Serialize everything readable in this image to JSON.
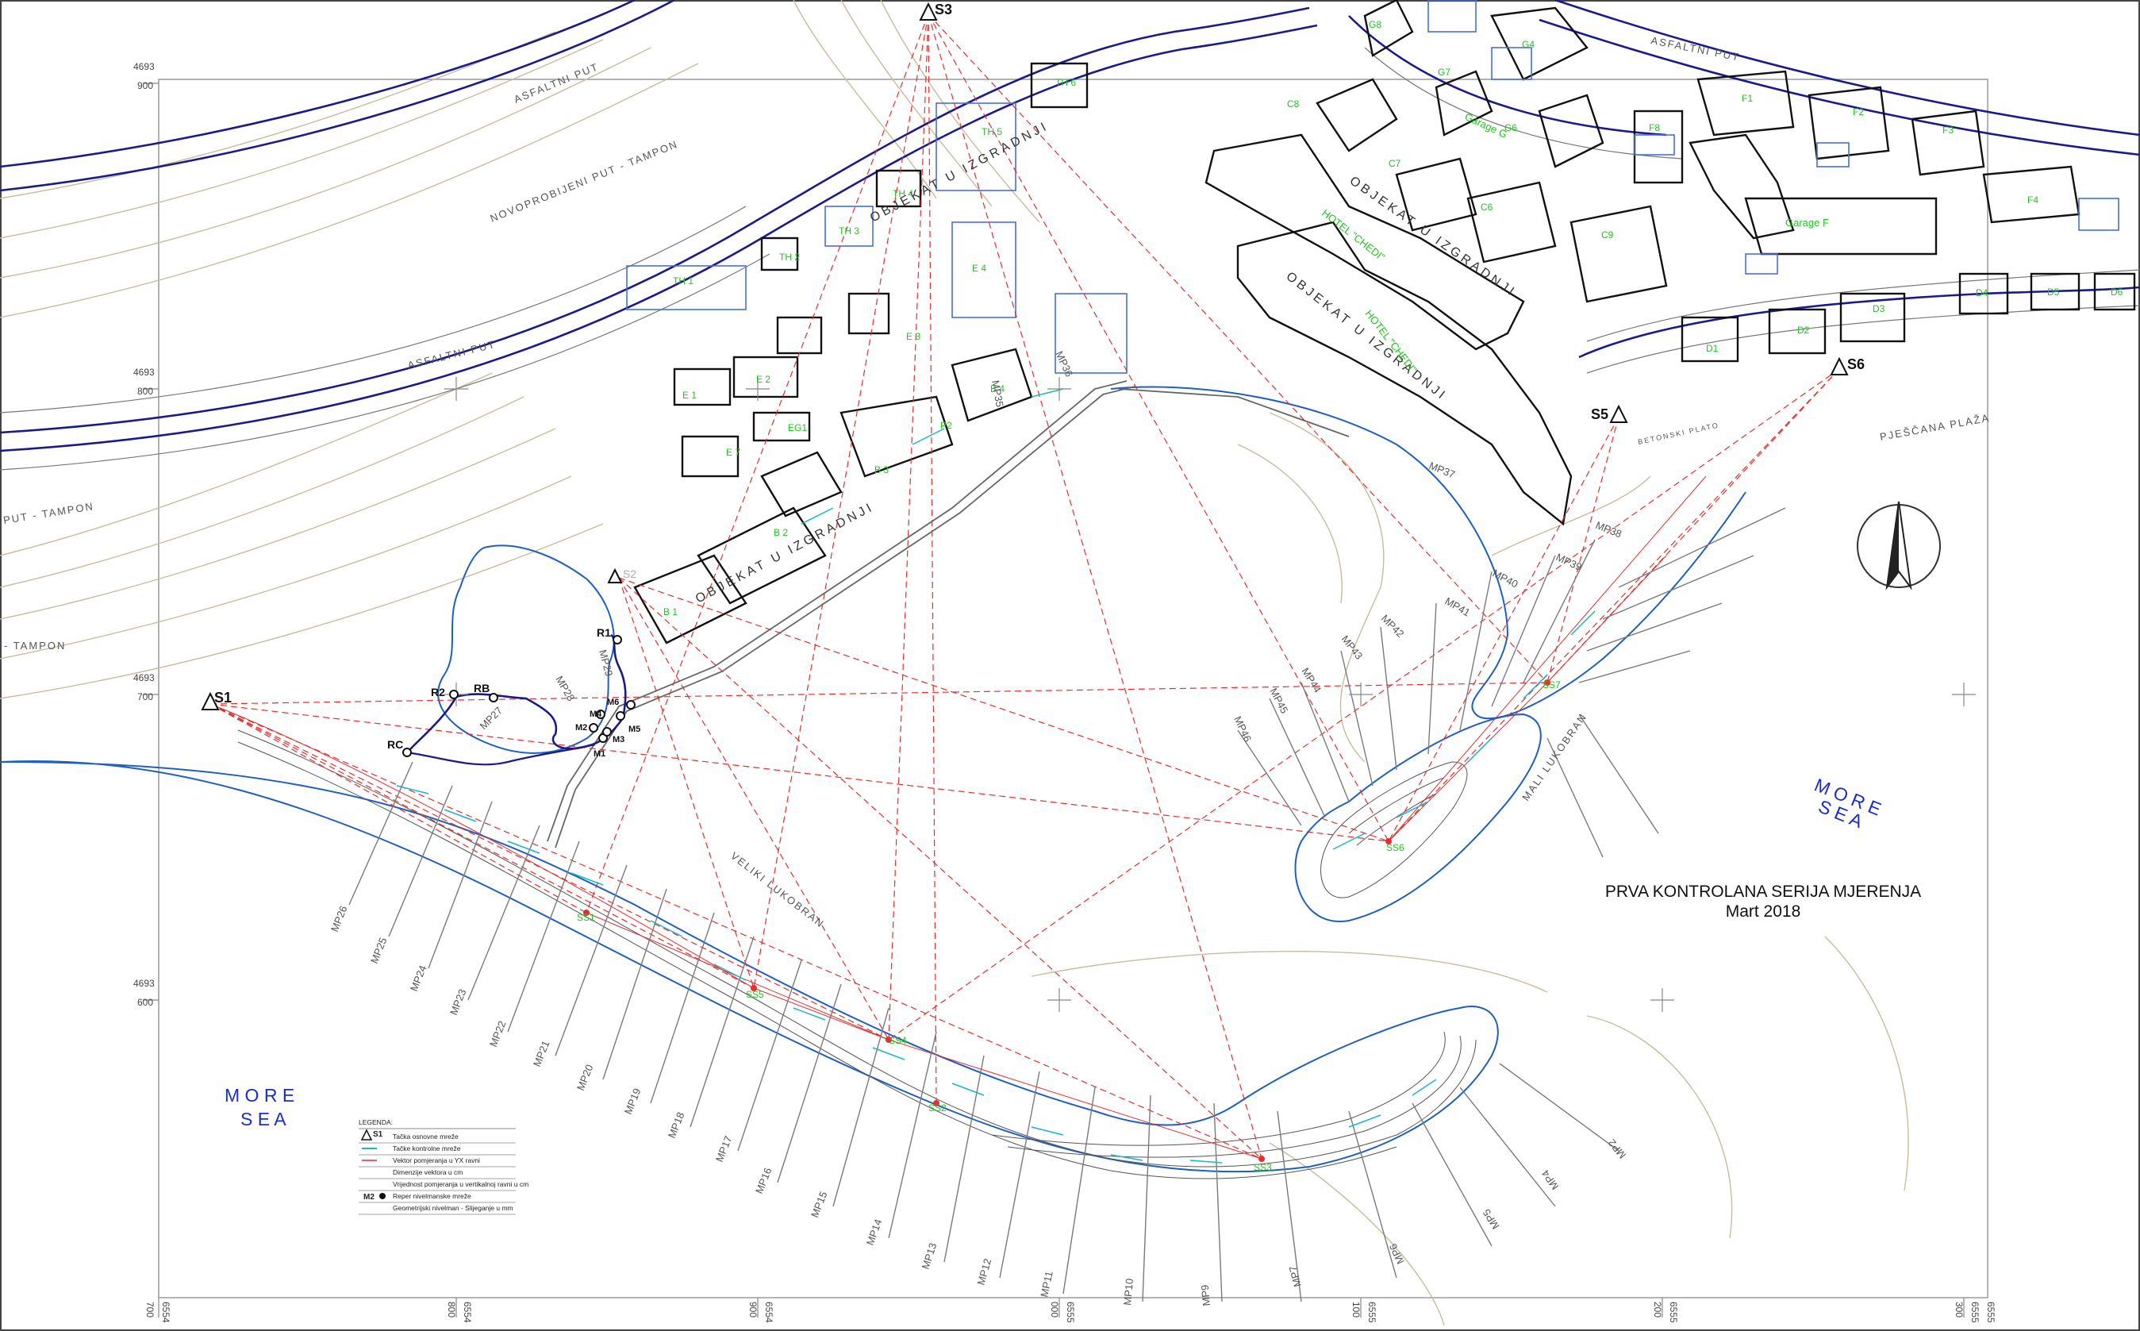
{
  "title": {
    "line1": "PRVA KONTROLANA SERIJA MJERENJA",
    "line2": "Mart 2018"
  },
  "sea_labels": {
    "left": [
      "M O R E",
      "S E A"
    ],
    "right": [
      "M O R E",
      "S E A"
    ]
  },
  "road_labels": {
    "asfaltni_1": "ASFALTNI PUT",
    "asfaltni_2": "ASFALTNI PUT",
    "novoprobijeni": "NOVOPROBIJENI PUT - TAMPON",
    "put_tampon_1": "PUT - TAMPON",
    "put_tampon_2": "- TAMPON",
    "betonski": "BETONSKI PLATO",
    "pjescana": "PJEŠČANA PLAŽA",
    "mali_lukobran": "MALI LUKOBRAN",
    "veliki_lukobran": "VELIKI LUKOBRAN"
  },
  "buildings": {
    "objekat_u_izgradnji": "OBJEKAT U IZGRADNJI",
    "hotel_chedi": "HOTEL \"CHEDI\"",
    "garage_g": "Garage G",
    "garage_f": "Garage F",
    "labels": [
      "TH 1",
      "TH 2",
      "TH 3",
      "TH 4",
      "TH 5",
      "TH 6",
      "E 1",
      "E 2",
      "E 3",
      "E 4",
      "E 7",
      "EG1",
      "B 1",
      "B 2",
      "B 3",
      "B 4",
      "P2",
      "G8",
      "G7",
      "G6",
      "G4",
      "C8",
      "C7",
      "C9",
      "C6",
      "F1",
      "F2",
      "F3",
      "F4",
      "F8",
      "D1",
      "D2",
      "D3",
      "D4",
      "D5",
      "D6"
    ]
  },
  "base_points": [
    "S1",
    "S3",
    "S5",
    "S6",
    "S2"
  ],
  "control_points": [
    "SS1",
    "SS2",
    "SS3",
    "SS4",
    "SS5",
    "SS6",
    "SS7"
  ],
  "benchmarks": [
    "R1",
    "R2",
    "RB",
    "RC",
    "M1",
    "M2",
    "M3",
    "M4",
    "M5",
    "M6"
  ],
  "profiles": [
    "MP1",
    "MP2",
    "MP3",
    "MP4",
    "MP5",
    "MP6",
    "MP7",
    "MP8",
    "MP9",
    "MP10",
    "MP11",
    "MP12",
    "MP13",
    "MP14",
    "MP15",
    "MP16",
    "MP17",
    "MP18",
    "MP19",
    "MP20",
    "MP21",
    "MP22",
    "MP23",
    "MP24",
    "MP25",
    "MP26",
    "MP27",
    "MP28",
    "MP29",
    "MP30",
    "MP31",
    "MP32",
    "MP33",
    "MP34",
    "MP35",
    "MP36",
    "MP37",
    "MP38",
    "MP39",
    "MP40",
    "MP41",
    "MP42",
    "MP43",
    "MP44",
    "MP45",
    "MP46"
  ],
  "grid": {
    "left": [
      {
        "top": "4693",
        "bottom": "900"
      },
      {
        "top": "4693",
        "bottom": "800"
      },
      {
        "top": "4693",
        "bottom": "700"
      },
      {
        "top": "4693",
        "bottom": "600"
      }
    ],
    "bottom": [
      "700",
      "6554",
      "800",
      "6554",
      "900",
      "6554",
      "6555",
      "000",
      "6555",
      "100",
      "6555",
      "200",
      "6555",
      "300",
      "6555"
    ]
  },
  "legend": {
    "title": "LEGENDA:",
    "items": [
      {
        "symbol": "S1",
        "text": "Tačka osnovne mreže"
      },
      {
        "symbol": "",
        "text": "Tačke kontrolne mreže"
      },
      {
        "symbol": "",
        "text": "Vektor pomjeranja u YX ravni"
      },
      {
        "symbol": "",
        "text": "Dimenzije vektora u cm"
      },
      {
        "symbol": "",
        "text": "Vrijednost pomjeranja u vertikalnoj ravni u cm"
      },
      {
        "symbol": "M2",
        "text": "Reper nivelmanske mreže"
      },
      {
        "symbol": "",
        "text": "Geometrijski nivelman - Slijeganje u mm"
      }
    ]
  },
  "colors": {
    "road": "#1a1a8c",
    "water": "#1f5fbf",
    "contour": "#b7a98c",
    "building": "#111111",
    "planned": "#4a6fd0",
    "label_green": "#22c322",
    "survey_red": "#e03030",
    "survey_cyan": "#19b6c9",
    "sea_text": "#1a2dc8",
    "pink_text": "#c814c8"
  }
}
